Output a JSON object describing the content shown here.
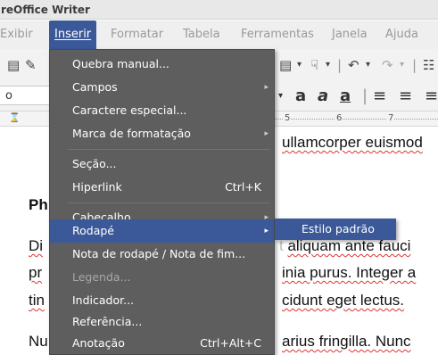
{
  "window": {
    "title": "reOffice Writer"
  },
  "menubar": {
    "items": [
      {
        "label": "Exibir"
      },
      {
        "label": "Inserir"
      },
      {
        "label": "Formatar"
      },
      {
        "label": "Tabela"
      },
      {
        "label": "Ferramentas"
      },
      {
        "label": "Janela"
      },
      {
        "label": "Ajuda"
      }
    ]
  },
  "toolbar": {
    "style_value": "o",
    "icons": [
      "save-icon",
      "edit-icon",
      "document-icon",
      "paint-bucket-icon",
      "undo-icon",
      "redo-icon"
    ],
    "text_icons": [
      "bold-a-icon",
      "italic-a-icon",
      "underline-a-icon",
      "align-left-icon",
      "align-center-icon"
    ]
  },
  "ruler": {
    "numbers": [
      "5",
      "6",
      "7"
    ]
  },
  "insert_menu": {
    "items": [
      {
        "label": "Quebra manual...",
        "shortcut": "",
        "submenu": false,
        "disabled": false
      },
      {
        "label": "Campos",
        "shortcut": "",
        "submenu": true,
        "disabled": false
      },
      {
        "label": "Caractere especial...",
        "shortcut": "",
        "submenu": false,
        "disabled": false
      },
      {
        "label": "Marca de formatação",
        "shortcut": "",
        "submenu": true,
        "disabled": false
      },
      {
        "label": "Seção...",
        "shortcut": "",
        "submenu": false,
        "disabled": false
      },
      {
        "label": "Hiperlink",
        "shortcut": "Ctrl+K",
        "submenu": false,
        "disabled": false
      },
      {
        "label": "Cabeçalho",
        "shortcut": "",
        "submenu": true,
        "disabled": false
      },
      {
        "label": "Rodapé",
        "shortcut": "",
        "submenu": true,
        "disabled": false,
        "highlighted": true
      },
      {
        "label": "Nota de rodapé / Nota de fim...",
        "shortcut": "",
        "submenu": false,
        "disabled": false
      },
      {
        "label": "Legenda...",
        "shortcut": "",
        "submenu": false,
        "disabled": true
      },
      {
        "label": "Indicador...",
        "shortcut": "",
        "submenu": false,
        "disabled": false
      },
      {
        "label": "Referência...",
        "shortcut": "",
        "submenu": false,
        "disabled": false
      },
      {
        "label": "Anotação",
        "shortcut": "Ctrl+Alt+C",
        "submenu": false,
        "disabled": false
      }
    ]
  },
  "footer_submenu": {
    "items": [
      {
        "label": "Estilo padrão"
      }
    ]
  },
  "document": {
    "lines": [
      "ullamcorper euismod",
      "Ph",
      "Di",
      "aliquam ante fauci",
      "pr",
      "inia purus. Integer a",
      "tin",
      "cidunt eget lectus.",
      "Nu",
      "arius fringilla. Nunc"
    ]
  },
  "colors": {
    "menu_bg": "#5e5e5e",
    "highlight": "#3b5998",
    "menu_text": "#ffffff",
    "disabled_text": "#a8a8a8"
  }
}
